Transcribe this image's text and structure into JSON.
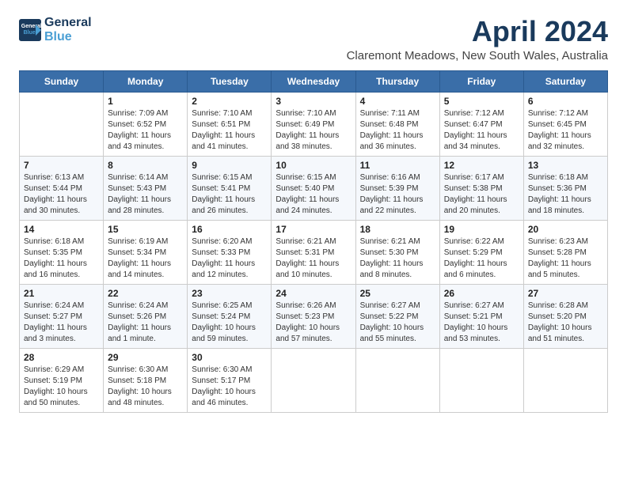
{
  "logo": {
    "line1": "General",
    "line2": "Blue"
  },
  "title": "April 2024",
  "subtitle": "Claremont Meadows, New South Wales, Australia",
  "days_of_week": [
    "Sunday",
    "Monday",
    "Tuesday",
    "Wednesday",
    "Thursday",
    "Friday",
    "Saturday"
  ],
  "weeks": [
    [
      {
        "day": "",
        "info": ""
      },
      {
        "day": "1",
        "info": "Sunrise: 7:09 AM\nSunset: 6:52 PM\nDaylight: 11 hours\nand 43 minutes."
      },
      {
        "day": "2",
        "info": "Sunrise: 7:10 AM\nSunset: 6:51 PM\nDaylight: 11 hours\nand 41 minutes."
      },
      {
        "day": "3",
        "info": "Sunrise: 7:10 AM\nSunset: 6:49 PM\nDaylight: 11 hours\nand 38 minutes."
      },
      {
        "day": "4",
        "info": "Sunrise: 7:11 AM\nSunset: 6:48 PM\nDaylight: 11 hours\nand 36 minutes."
      },
      {
        "day": "5",
        "info": "Sunrise: 7:12 AM\nSunset: 6:47 PM\nDaylight: 11 hours\nand 34 minutes."
      },
      {
        "day": "6",
        "info": "Sunrise: 7:12 AM\nSunset: 6:45 PM\nDaylight: 11 hours\nand 32 minutes."
      }
    ],
    [
      {
        "day": "7",
        "info": "Sunrise: 6:13 AM\nSunset: 5:44 PM\nDaylight: 11 hours\nand 30 minutes."
      },
      {
        "day": "8",
        "info": "Sunrise: 6:14 AM\nSunset: 5:43 PM\nDaylight: 11 hours\nand 28 minutes."
      },
      {
        "day": "9",
        "info": "Sunrise: 6:15 AM\nSunset: 5:41 PM\nDaylight: 11 hours\nand 26 minutes."
      },
      {
        "day": "10",
        "info": "Sunrise: 6:15 AM\nSunset: 5:40 PM\nDaylight: 11 hours\nand 24 minutes."
      },
      {
        "day": "11",
        "info": "Sunrise: 6:16 AM\nSunset: 5:39 PM\nDaylight: 11 hours\nand 22 minutes."
      },
      {
        "day": "12",
        "info": "Sunrise: 6:17 AM\nSunset: 5:38 PM\nDaylight: 11 hours\nand 20 minutes."
      },
      {
        "day": "13",
        "info": "Sunrise: 6:18 AM\nSunset: 5:36 PM\nDaylight: 11 hours\nand 18 minutes."
      }
    ],
    [
      {
        "day": "14",
        "info": "Sunrise: 6:18 AM\nSunset: 5:35 PM\nDaylight: 11 hours\nand 16 minutes."
      },
      {
        "day": "15",
        "info": "Sunrise: 6:19 AM\nSunset: 5:34 PM\nDaylight: 11 hours\nand 14 minutes."
      },
      {
        "day": "16",
        "info": "Sunrise: 6:20 AM\nSunset: 5:33 PM\nDaylight: 11 hours\nand 12 minutes."
      },
      {
        "day": "17",
        "info": "Sunrise: 6:21 AM\nSunset: 5:31 PM\nDaylight: 11 hours\nand 10 minutes."
      },
      {
        "day": "18",
        "info": "Sunrise: 6:21 AM\nSunset: 5:30 PM\nDaylight: 11 hours\nand 8 minutes."
      },
      {
        "day": "19",
        "info": "Sunrise: 6:22 AM\nSunset: 5:29 PM\nDaylight: 11 hours\nand 6 minutes."
      },
      {
        "day": "20",
        "info": "Sunrise: 6:23 AM\nSunset: 5:28 PM\nDaylight: 11 hours\nand 5 minutes."
      }
    ],
    [
      {
        "day": "21",
        "info": "Sunrise: 6:24 AM\nSunset: 5:27 PM\nDaylight: 11 hours\nand 3 minutes."
      },
      {
        "day": "22",
        "info": "Sunrise: 6:24 AM\nSunset: 5:26 PM\nDaylight: 11 hours\nand 1 minute."
      },
      {
        "day": "23",
        "info": "Sunrise: 6:25 AM\nSunset: 5:24 PM\nDaylight: 10 hours\nand 59 minutes."
      },
      {
        "day": "24",
        "info": "Sunrise: 6:26 AM\nSunset: 5:23 PM\nDaylight: 10 hours\nand 57 minutes."
      },
      {
        "day": "25",
        "info": "Sunrise: 6:27 AM\nSunset: 5:22 PM\nDaylight: 10 hours\nand 55 minutes."
      },
      {
        "day": "26",
        "info": "Sunrise: 6:27 AM\nSunset: 5:21 PM\nDaylight: 10 hours\nand 53 minutes."
      },
      {
        "day": "27",
        "info": "Sunrise: 6:28 AM\nSunset: 5:20 PM\nDaylight: 10 hours\nand 51 minutes."
      }
    ],
    [
      {
        "day": "28",
        "info": "Sunrise: 6:29 AM\nSunset: 5:19 PM\nDaylight: 10 hours\nand 50 minutes."
      },
      {
        "day": "29",
        "info": "Sunrise: 6:30 AM\nSunset: 5:18 PM\nDaylight: 10 hours\nand 48 minutes."
      },
      {
        "day": "30",
        "info": "Sunrise: 6:30 AM\nSunset: 5:17 PM\nDaylight: 10 hours\nand 46 minutes."
      },
      {
        "day": "",
        "info": ""
      },
      {
        "day": "",
        "info": ""
      },
      {
        "day": "",
        "info": ""
      },
      {
        "day": "",
        "info": ""
      }
    ]
  ]
}
